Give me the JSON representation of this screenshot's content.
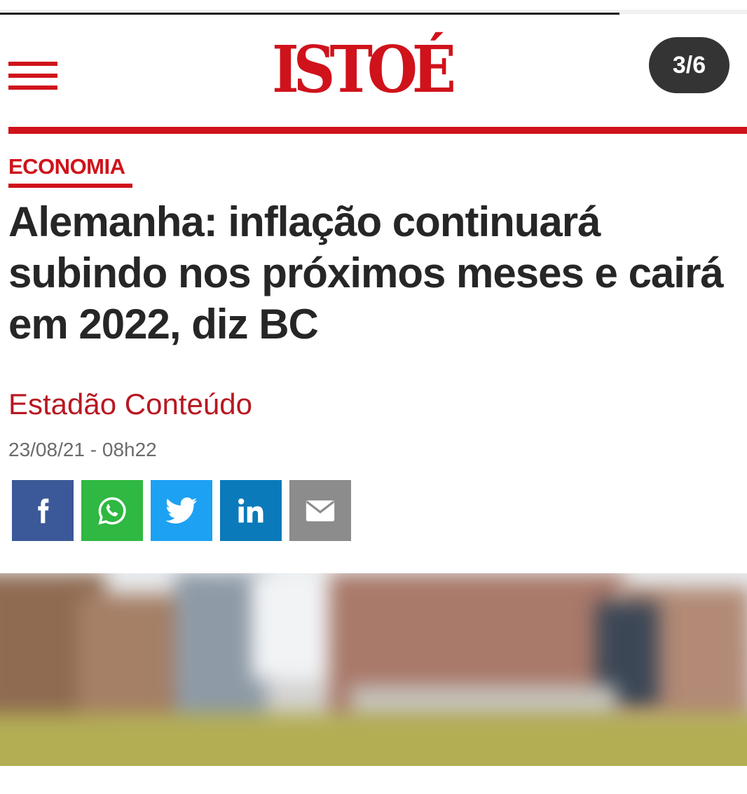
{
  "header": {
    "menu_icon": "hamburger-menu-icon",
    "logo_text": "ISTOÉ",
    "pager": "3/6",
    "colors": {
      "brand_red": "#d0121b",
      "pager_bg": "#343434"
    }
  },
  "article": {
    "section": "ECONOMIA",
    "headline": "Alemanha: inflação continuará\nsubindo nos próximos meses e cairá\nem 2022, diz BC",
    "author": "Estadão Conteúdo",
    "date": "23/08/21 - 08h22"
  },
  "share": {
    "buttons": [
      {
        "name": "facebook",
        "icon": "facebook-icon",
        "color": "#3b5998"
      },
      {
        "name": "whatsapp",
        "icon": "whatsapp-icon",
        "color": "#2fb842"
      },
      {
        "name": "twitter",
        "icon": "twitter-icon",
        "color": "#1da1f2"
      },
      {
        "name": "linkedin",
        "icon": "linkedin-icon",
        "color": "#0a7aba"
      },
      {
        "name": "email",
        "icon": "email-icon",
        "color": "#8c8c8c"
      }
    ]
  },
  "photo": {
    "description_icon": "article-photo"
  }
}
